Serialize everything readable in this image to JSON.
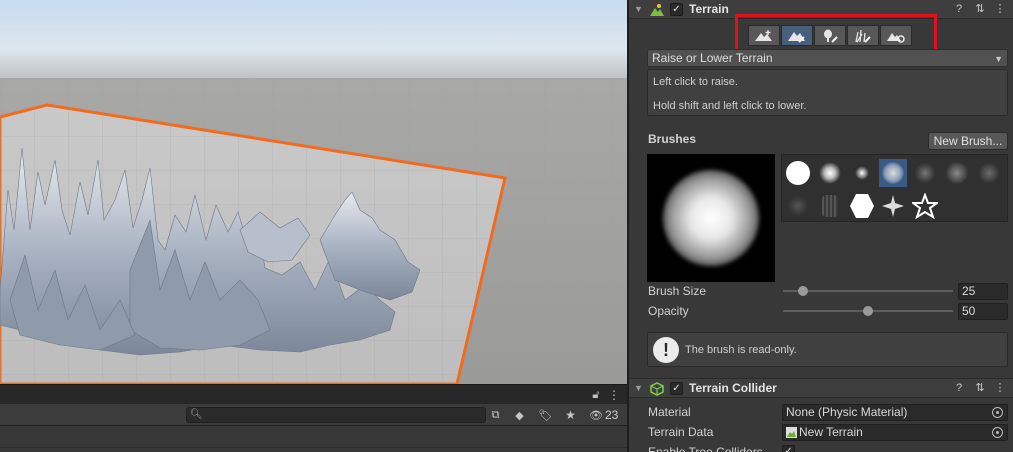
{
  "inspector": {
    "terrain": {
      "title": "Terrain",
      "checkbox_mark": "✓",
      "tools": [
        {
          "icon": "create-neighbor-terrains-icon",
          "active": false
        },
        {
          "icon": "paint-terrain-icon",
          "active": true
        },
        {
          "icon": "paint-trees-icon",
          "active": false
        },
        {
          "icon": "paint-details-icon",
          "active": false
        },
        {
          "icon": "terrain-settings-icon",
          "active": false
        }
      ],
      "mode_dropdown": "Raise or Lower Terrain",
      "help_line1": "Left click to raise.",
      "help_line2": "Hold shift and left click to lower.",
      "brushes_label": "Brushes",
      "new_brush_button": "New Brush...",
      "brush_size_label": "Brush Size",
      "brush_size_value": "25",
      "brush_size_fraction": 0.12,
      "opacity_label": "Opacity",
      "opacity_value": "50",
      "opacity_fraction": 0.5,
      "readonly_message": "The brush is read-only.",
      "info_glyph": "!"
    },
    "collider": {
      "title": "Terrain Collider",
      "checkbox_mark": "✓",
      "material_label": "Material",
      "material_value": "None (Physic Material)",
      "terrain_data_label": "Terrain Data",
      "terrain_data_value": "New Terrain",
      "enable_tree_label": "Enable Tree Colliders",
      "enable_tree_mark": "✓"
    },
    "header_icons": [
      "help-icon",
      "presets-icon",
      "more-options-icon"
    ]
  },
  "bottom_panel": {
    "hidden_count": "23",
    "search_placeholder": ""
  },
  "colors": {
    "selection_outline": "#f26b1d",
    "highlight_box": "#e0101e",
    "active_tool": "#46607c",
    "sky_top": "#c8dbee",
    "ground": "#a9a9a9"
  }
}
